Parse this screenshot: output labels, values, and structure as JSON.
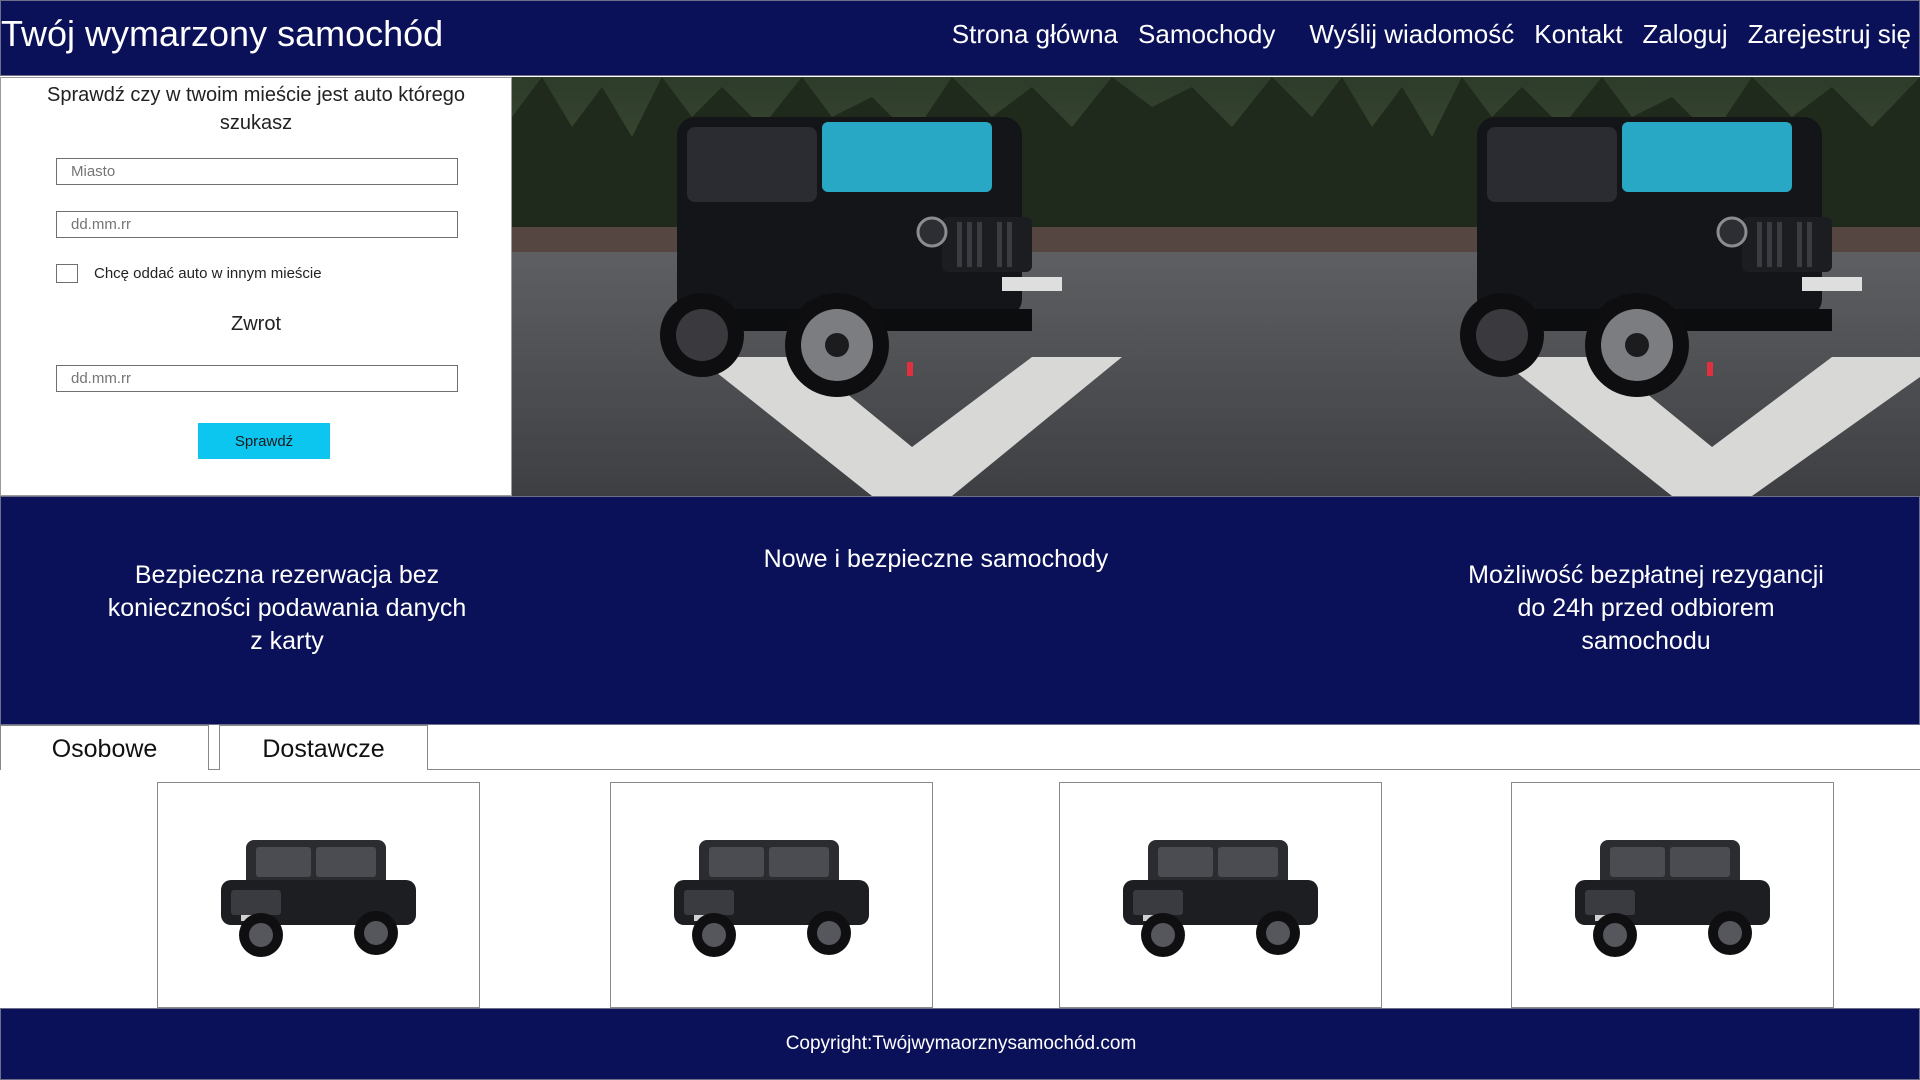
{
  "header": {
    "title": "Twój wymarzony samochód",
    "nav": [
      "Strona główna",
      "Samochody",
      "Wyślij wiadomość",
      "Kontakt",
      "Zaloguj",
      "Zarejestruj się"
    ]
  },
  "search": {
    "title": "Sprawdź czy w twoim mieście jest auto którego szukasz",
    "city_placeholder": "Miasto",
    "pickup_date_placeholder": "dd.mm.rr",
    "different_city_label": "Chcę oddać auto w innym mieście",
    "return_label": "Zwrot",
    "return_date_placeholder": "dd.mm.rr",
    "submit_label": "Sprawdź"
  },
  "features": [
    "Bezpieczna rezerwacja bez konieczności podawania danych z karty",
    "Nowe i bezpieczne samochody",
    "Możliwość bezpłatnej rezygancji do 24h przed odbiorem samochodu"
  ],
  "tabs": [
    "Osobowe",
    "Dostawcze"
  ],
  "footer": {
    "copyright": "Copyright:Twójwymaorznysamochód.com"
  },
  "colors": {
    "navy": "#0a1159",
    "button": "#0cc6f0",
    "white": "#ffffff"
  }
}
